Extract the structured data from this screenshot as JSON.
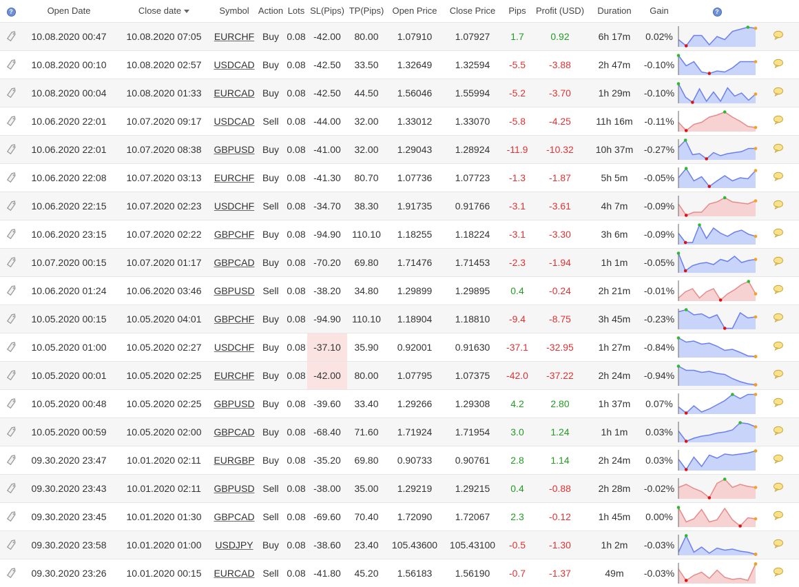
{
  "header": {
    "open_date": "Open Date",
    "close_date": "Close date",
    "symbol": "Symbol",
    "action": "Action",
    "lots": "Lots",
    "sl": "SL(Pips)",
    "tp": "TP(Pips)",
    "open_price": "Open Price",
    "close_price": "Close Price",
    "pips": "Pips",
    "profit": "Profit (USD)",
    "duration": "Duration",
    "gain": "Gain"
  },
  "colors": {
    "pos_line": "#6a7ff0",
    "pos_fill": "#c9d4fb",
    "neg_line": "#e88a8a",
    "neg_fill": "#f6d2d2",
    "marker_high": "#2fb82f",
    "marker_low": "#dd1111",
    "marker_end": "#f5a020"
  },
  "rows": [
    {
      "open": "10.08.2020 00:47",
      "close": "10.08.2020 07:05",
      "symbol": "EURCHF",
      "action": "Buy",
      "lots": "0.08",
      "sl": "-42.00",
      "tp": "80.00",
      "open_price": "1.07910",
      "close_price": "1.07927",
      "pips": "1.7",
      "profit": "0.92",
      "duration": "6h 17m",
      "gain": "0.02%",
      "spark": [
        0.35,
        0.05,
        0.55,
        0.55,
        0.1,
        0.5,
        0.35,
        0.75,
        0.85,
        0.95,
        0.9
      ]
    },
    {
      "open": "10.08.2020 00:10",
      "close": "10.08.2020 02:57",
      "symbol": "USDCAD",
      "action": "Buy",
      "lots": "0.08",
      "sl": "-42.50",
      "tp": "33.50",
      "open_price": "1.32649",
      "close_price": "1.32594",
      "pips": "-5.5",
      "profit": "-3.88",
      "duration": "2h 47m",
      "gain": "-0.10%",
      "spark": [
        0.95,
        0.45,
        0.65,
        0.15,
        0.08,
        0.2,
        0.15,
        0.35,
        0.65,
        0.65,
        0.65
      ]
    },
    {
      "open": "10.08.2020 00:04",
      "close": "10.08.2020 01:33",
      "symbol": "EURCAD",
      "action": "Buy",
      "lots": "0.08",
      "sl": "-42.50",
      "tp": "44.50",
      "open_price": "1.56046",
      "close_price": "1.55994",
      "pips": "-5.2",
      "profit": "-3.70",
      "duration": "1h 29m",
      "gain": "-0.10%",
      "spark": [
        0.95,
        0.3,
        0.05,
        0.7,
        0.1,
        0.55,
        0.1,
        0.75,
        0.35,
        0.5,
        0.15,
        0.45
      ]
    },
    {
      "open": "10.06.2020 22:01",
      "close": "10.07.2020 09:17",
      "symbol": "USDCAD",
      "action": "Sell",
      "lots": "0.08",
      "sl": "-44.00",
      "tp": "32.00",
      "open_price": "1.33012",
      "close_price": "1.33070",
      "pips": "-5.8",
      "profit": "-4.25",
      "duration": "11h 16m",
      "gain": "-0.11%",
      "spark": [
        0.45,
        0.05,
        0.35,
        0.45,
        0.7,
        0.8,
        0.95,
        0.7,
        0.5,
        0.25,
        0.2
      ]
    },
    {
      "open": "10.06.2020 22:01",
      "close": "10.07.2020 08:38",
      "symbol": "GBPUSD",
      "action": "Buy",
      "lots": "0.08",
      "sl": "-41.00",
      "tp": "32.00",
      "open_price": "1.29043",
      "close_price": "1.28924",
      "pips": "-11.9",
      "profit": "-10.32",
      "duration": "10h 37m",
      "gain": "-0.27%",
      "spark": [
        0.6,
        0.95,
        0.25,
        0.3,
        0.05,
        0.35,
        0.2,
        0.3,
        0.35,
        0.4,
        0.55,
        0.55
      ]
    },
    {
      "open": "10.06.2020 22:08",
      "close": "10.07.2020 03:13",
      "symbol": "EURCHF",
      "action": "Buy",
      "lots": "0.08",
      "sl": "-41.30",
      "tp": "80.70",
      "open_price": "1.07736",
      "close_price": "1.07723",
      "pips": "-1.3",
      "profit": "-1.87",
      "duration": "5h 5m",
      "gain": "-0.05%",
      "spark": [
        0.5,
        0.95,
        0.35,
        0.55,
        0.08,
        0.35,
        0.6,
        0.35,
        0.5,
        0.45,
        0.85
      ]
    },
    {
      "open": "10.06.2020 22:15",
      "close": "10.07.2020 02:23",
      "symbol": "USDCHF",
      "action": "Sell",
      "lots": "0.08",
      "sl": "-34.70",
      "tp": "38.30",
      "open_price": "1.91735",
      "close_price": "0.91766",
      "pips": "-3.1",
      "profit": "-3.61",
      "duration": "4h 7m",
      "gain": "-0.09%",
      "spark": [
        0.6,
        0.05,
        0.2,
        0.2,
        0.6,
        0.7,
        0.9,
        0.7,
        0.65,
        0.6,
        0.75
      ]
    },
    {
      "open": "10.06.2020 23:15",
      "close": "10.07.2020 02:22",
      "symbol": "GBPCHF",
      "action": "Buy",
      "lots": "0.08",
      "sl": "-94.90",
      "tp": "110.10",
      "open_price": "1.18255",
      "close_price": "1.18224",
      "pips": "-3.1",
      "profit": "-3.30",
      "duration": "3h 6m",
      "gain": "-0.09%",
      "spark": [
        0.55,
        0.1,
        0.1,
        0.95,
        0.3,
        0.8,
        0.55,
        0.4,
        0.6,
        0.7,
        0.5,
        0.4
      ]
    },
    {
      "open": "10.07.2020 00:15",
      "close": "10.07.2020 01:17",
      "symbol": "GBPCAD",
      "action": "Buy",
      "lots": "0.08",
      "sl": "-70.20",
      "tp": "69.80",
      "open_price": "1.71476",
      "close_price": "1.71453",
      "pips": "-2.3",
      "profit": "-1.94",
      "duration": "1h 1m",
      "gain": "-0.05%",
      "spark": [
        0.95,
        0.1,
        0.35,
        0.45,
        0.5,
        0.4,
        0.65,
        0.55,
        0.8,
        0.5,
        0.6,
        0.65
      ]
    },
    {
      "open": "10.06.2020 01:24",
      "close": "10.06.2020 03:46",
      "symbol": "GBPUSD",
      "action": "Sell",
      "lots": "0.08",
      "sl": "-38.20",
      "tp": "34.80",
      "open_price": "1.29899",
      "close_price": "1.29895",
      "pips": "0.4",
      "profit": "-0.24",
      "duration": "2h 21m",
      "gain": "-0.01%",
      "spark": [
        0.15,
        0.45,
        0.6,
        0.15,
        0.45,
        0.6,
        0.05,
        0.35,
        0.55,
        0.8,
        0.95,
        0.35
      ]
    },
    {
      "open": "10.05.2020 00:15",
      "close": "10.05.2020 04:01",
      "symbol": "GBPCHF",
      "action": "Buy",
      "lots": "0.08",
      "sl": "-94.90",
      "tp": "110.10",
      "open_price": "1.18904",
      "close_price": "1.18810",
      "pips": "-9.4",
      "profit": "-8.75",
      "duration": "3h 45m",
      "gain": "-0.23%",
      "spark": [
        0.85,
        0.95,
        0.7,
        0.75,
        0.55,
        0.7,
        0.05,
        0.05,
        0.8,
        0.55,
        0.6
      ]
    },
    {
      "open": "10.05.2020 01:00",
      "close": "10.05.2020 02:27",
      "symbol": "USDCHF",
      "action": "Buy",
      "lots": "0.08",
      "sl": "-37.10",
      "tp": "35.90",
      "open_price": "0.92001",
      "close_price": "0.91630",
      "pips": "-37.1",
      "profit": "-32.95",
      "duration": "1h 27m",
      "gain": "-0.84%",
      "spark": [
        0.95,
        0.75,
        0.8,
        0.65,
        0.7,
        0.55,
        0.35,
        0.4,
        0.25,
        0.08,
        0.05
      ]
    },
    {
      "open": "10.05.2020 00:01",
      "close": "10.05.2020 02:25",
      "symbol": "EURCHF",
      "action": "Buy",
      "lots": "0.08",
      "sl": "-42.00",
      "tp": "80.00",
      "open_price": "1.07795",
      "close_price": "1.07375",
      "pips": "-42.0",
      "profit": "-37.22",
      "duration": "2h 24m",
      "gain": "-0.94%",
      "spark": [
        0.95,
        0.75,
        0.75,
        0.65,
        0.7,
        0.6,
        0.55,
        0.35,
        0.2,
        0.1,
        0.05
      ]
    },
    {
      "open": "10.05.2020 00:48",
      "close": "10.05.2020 02:25",
      "symbol": "GBPUSD",
      "action": "Buy",
      "lots": "0.08",
      "sl": "-39.60",
      "tp": "33.40",
      "open_price": "1.29266",
      "close_price": "1.29308",
      "pips": "4.2",
      "profit": "2.80",
      "duration": "1h 37m",
      "gain": "0.07%",
      "spark": [
        0.35,
        0.05,
        0.4,
        0.1,
        0.25,
        0.45,
        0.65,
        0.95,
        0.75,
        0.95,
        0.95
      ]
    },
    {
      "open": "10.05.2020 00:59",
      "close": "10.05.2020 02:00",
      "symbol": "GBPCAD",
      "action": "Buy",
      "lots": "0.08",
      "sl": "-68.40",
      "tp": "71.60",
      "open_price": "1.71924",
      "close_price": "1.71954",
      "pips": "3.0",
      "profit": "1.24",
      "duration": "1h 1m",
      "gain": "0.03%",
      "spark": [
        0.55,
        0.05,
        0.2,
        0.3,
        0.35,
        0.45,
        0.5,
        0.6,
        0.95,
        0.9,
        0.75
      ]
    },
    {
      "open": "09.30.2020 23:47",
      "close": "10.01.2020 02:11",
      "symbol": "EURGBP",
      "action": "Buy",
      "lots": "0.08",
      "sl": "-35.20",
      "tp": "69.80",
      "open_price": "0.90733",
      "close_price": "0.90761",
      "pips": "2.8",
      "profit": "1.14",
      "duration": "2h 24m",
      "gain": "0.03%",
      "spark": [
        0.55,
        0.05,
        0.65,
        0.2,
        0.75,
        0.6,
        0.8,
        0.75,
        0.8,
        0.85,
        0.95
      ]
    },
    {
      "open": "09.30.2020 23:43",
      "close": "10.01.2020 02:11",
      "symbol": "GBPUSD",
      "action": "Sell",
      "lots": "0.08",
      "sl": "-38.00",
      "tp": "35.00",
      "open_price": "1.29219",
      "close_price": "1.29215",
      "pips": "0.4",
      "profit": "-0.88",
      "duration": "2h 28m",
      "gain": "-0.02%",
      "spark": [
        0.55,
        0.7,
        0.5,
        0.35,
        0.05,
        0.75,
        0.95,
        0.55,
        0.7,
        0.6,
        0.55
      ]
    },
    {
      "open": "09.30.2020 23:45",
      "close": "10.01.2020 01:30",
      "symbol": "GBPCAD",
      "action": "Sell",
      "lots": "0.08",
      "sl": "-69.60",
      "tp": "70.40",
      "open_price": "1.72090",
      "close_price": "1.72067",
      "pips": "2.3",
      "profit": "-0.12",
      "duration": "1h 45m",
      "gain": "0.00%",
      "spark": [
        0.95,
        0.25,
        0.4,
        0.85,
        0.25,
        0.35,
        0.9,
        0.35,
        0.05,
        0.45,
        0.4
      ]
    },
    {
      "open": "09.30.2020 23:58",
      "close": "10.01.2020 01:00",
      "symbol": "USDJPY",
      "action": "Buy",
      "lots": "0.08",
      "sl": "-38.60",
      "tp": "23.40",
      "open_price": "105.43600",
      "close_price": "105.43100",
      "pips": "-0.5",
      "profit": "-1.30",
      "duration": "1h 2m",
      "gain": "-0.03%",
      "spark": [
        0.15,
        0.95,
        0.15,
        0.4,
        0.1,
        0.35,
        0.25,
        0.3,
        0.2,
        0.15,
        0.05
      ]
    },
    {
      "open": "09.30.2020 23:26",
      "close": "10.01.2020 00:15",
      "symbol": "EURCAD",
      "action": "Sell",
      "lots": "0.08",
      "sl": "-41.80",
      "tp": "45.20",
      "open_price": "1.56183",
      "close_price": "1.56190",
      "pips": "-0.7",
      "profit": "-1.37",
      "duration": "49m",
      "gain": "-0.03%",
      "spark": [
        0.7,
        0.15,
        0.4,
        0.55,
        0.25,
        0.65,
        0.3,
        0.2,
        0.25,
        0.15,
        0.95
      ]
    }
  ]
}
